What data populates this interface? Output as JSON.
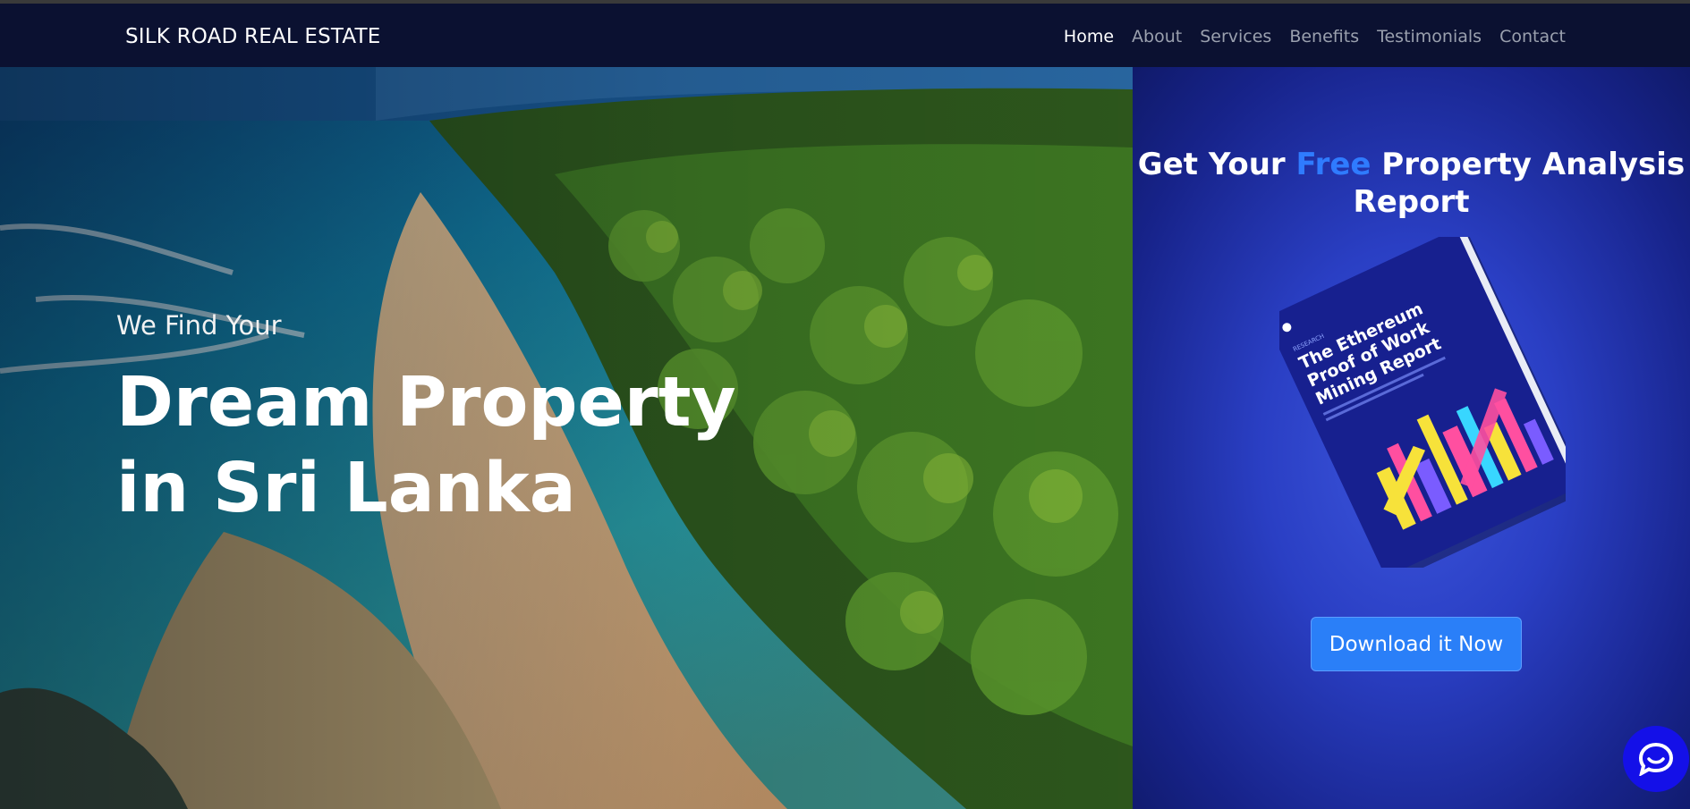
{
  "nav": {
    "brand": "SILK ROAD REAL ESTATE",
    "links": [
      {
        "label": "Home",
        "active": true
      },
      {
        "label": "About",
        "active": false
      },
      {
        "label": "Services",
        "active": false
      },
      {
        "label": "Benefits",
        "active": false
      },
      {
        "label": "Testimonials",
        "active": false
      },
      {
        "label": "Contact",
        "active": false
      }
    ]
  },
  "hero": {
    "subtitle": "We Find Your",
    "headline": "Dream Property in Sri Lanka"
  },
  "offer": {
    "title_part1": "Get Your ",
    "title_highlight": "Free",
    "title_part2": " Property Analysis Report",
    "book": {
      "label": "RESEARCH",
      "title_line1": "The Ethereum",
      "title_line2": "Proof of Work",
      "title_line3": "Mining Report",
      "icon": "book-cover"
    },
    "cta_label": "Download it Now"
  },
  "chat": {
    "icon": "chat-bubble-icon"
  },
  "colors": {
    "navbar": "#0b1131",
    "accent": "#2f7bff",
    "cta": "#2a7ff8",
    "chat": "#1410e8"
  }
}
